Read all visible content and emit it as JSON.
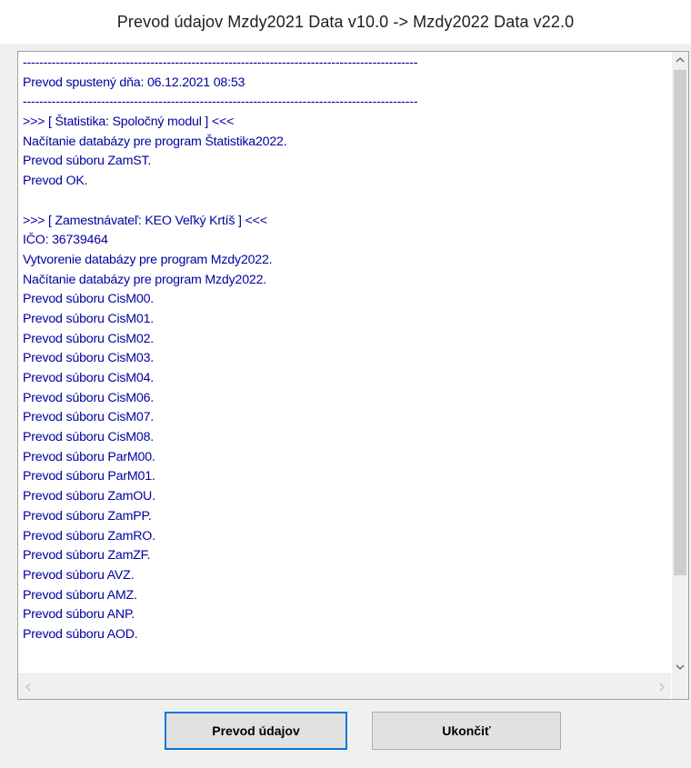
{
  "window": {
    "title": "Prevod údajov Mzdy2021 Data v10.0 ->  Mzdy2022 Data v22.0"
  },
  "log": {
    "lines": [
      "------------------------------------------------------------------------------------------------",
      "Prevod spustený dňa: 06.12.2021 08:53",
      "------------------------------------------------------------------------------------------------",
      ">>> [ Štatistika: Spoločný modul ] <<<",
      "Načítanie databázy pre program Štatistika2022.",
      "Prevod súboru ZamST.",
      "Prevod OK.",
      "",
      ">>> [ Zamestnávateľ: KEO Veľký Krtíš ] <<<",
      "IČO: 36739464",
      "Vytvorenie databázy pre program Mzdy2022.",
      "Načítanie databázy pre program Mzdy2022.",
      "Prevod súboru CisM00.",
      "Prevod súboru CisM01.",
      "Prevod súboru CisM02.",
      "Prevod súboru CisM03.",
      "Prevod súboru CisM04.",
      "Prevod súboru CisM06.",
      "Prevod súboru CisM07.",
      "Prevod súboru CisM08.",
      "Prevod súboru ParM00.",
      "Prevod súboru ParM01.",
      "Prevod súboru ZamOU.",
      "Prevod súboru ZamPP.",
      "Prevod súboru ZamRO.",
      "Prevod súboru ZamZF.",
      "Prevod súboru AVZ.",
      "Prevod súboru AMZ.",
      "Prevod súboru ANP.",
      "Prevod súboru AOD."
    ]
  },
  "buttons": {
    "convert_label": "Prevod údajov",
    "close_label": "Ukončiť"
  },
  "icons": {
    "scroll_up": "chevron-up-icon",
    "scroll_down": "chevron-down-icon",
    "scroll_left": "chevron-left-icon",
    "scroll_right": "chevron-right-icon"
  },
  "colors": {
    "log_text": "#0000a0",
    "primary_button_border": "#0078d7"
  }
}
